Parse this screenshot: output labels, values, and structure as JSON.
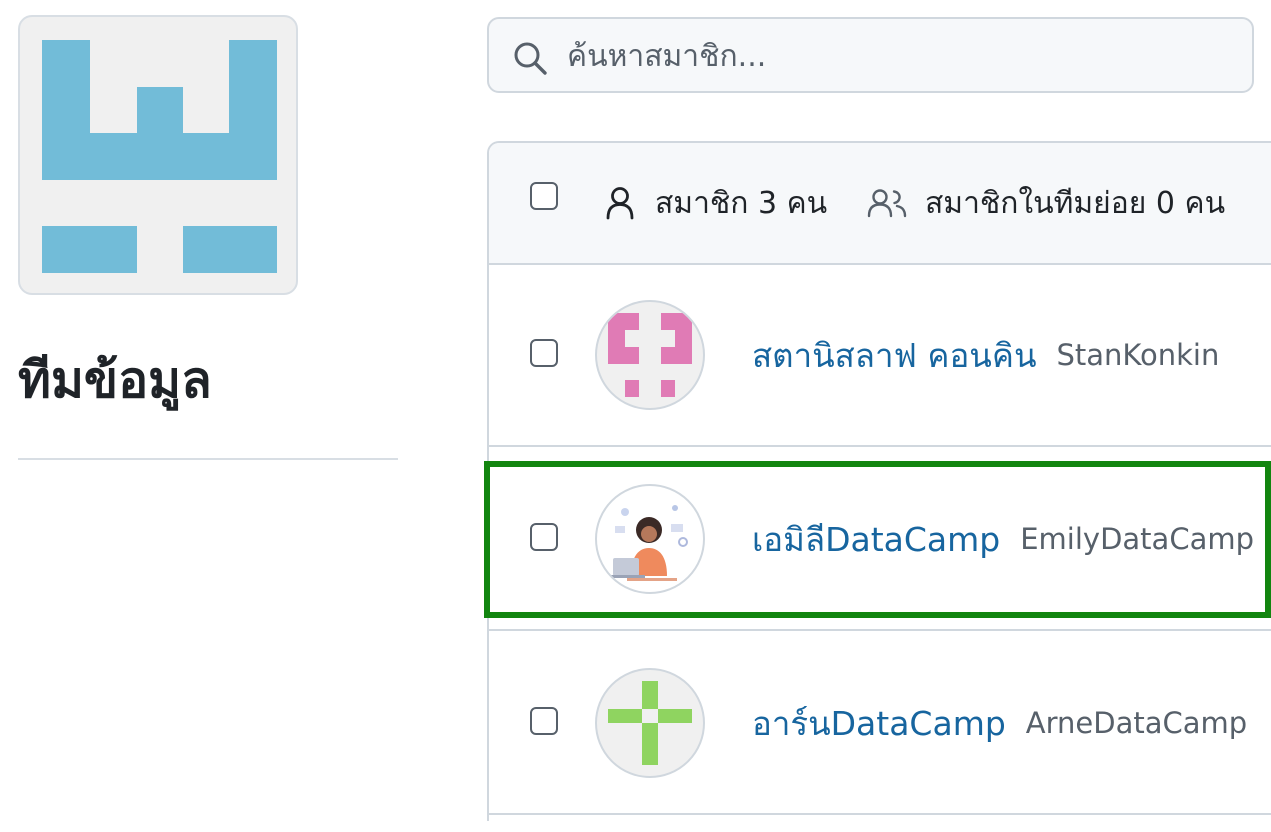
{
  "team": {
    "name": "ทีมข้อมูล",
    "avatar_icon": "team-identicon",
    "avatar_color": "#72bcd8"
  },
  "search": {
    "placeholder": "ค้นหาสมาชิก...",
    "value": ""
  },
  "members_header": {
    "members_label": "สมาชิก 3 คน",
    "members_icon": "person-icon",
    "child_team_label": "สมาชิกในทีมย่อย 0 คน",
    "child_team_icon": "people-icon"
  },
  "members": [
    {
      "display_name": "สตานิสลาฟ คอนคิน",
      "login": "StanKonkin",
      "avatar": "pink-identicon",
      "avatar_color": "#e07bb5",
      "checked": false
    },
    {
      "display_name": "เอมิลีDataCamp",
      "login": "EmilyDataCamp",
      "avatar": "illustrated-woman-avatar",
      "checked": false,
      "highlighted": true
    },
    {
      "display_name": "อาร์นDataCamp",
      "login": "ArneDataCamp",
      "avatar": "green-identicon",
      "avatar_color": "#8fd460",
      "checked": false
    }
  ],
  "colors": {
    "link": "#17659f",
    "highlight_border": "#12850f"
  }
}
